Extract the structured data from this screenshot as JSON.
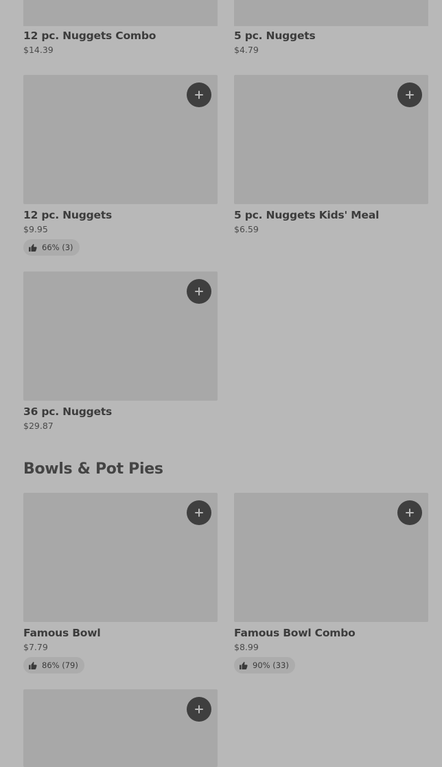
{
  "items": [
    {
      "name": "12 pc. Nuggets Combo",
      "price": "$14.39"
    },
    {
      "name": "5 pc. Nuggets",
      "price": "$4.79"
    },
    {
      "name": "12 pc. Nuggets",
      "price": "$9.95",
      "rating": "66% (3)"
    },
    {
      "name": "5 pc. Nuggets Kids' Meal",
      "price": "$6.59"
    },
    {
      "name": "36 pc. Nuggets",
      "price": "$29.87"
    }
  ],
  "section": {
    "title": "Bowls & Pot Pies"
  },
  "bowls": [
    {
      "name": "Famous Bowl",
      "price": "$7.79",
      "rating": "86% (79)"
    },
    {
      "name": "Famous Bowl Combo",
      "price": "$8.99",
      "rating": "90% (33)"
    }
  ],
  "icons": {
    "add": "plus-icon",
    "rating": "thumbs-up-icon"
  }
}
